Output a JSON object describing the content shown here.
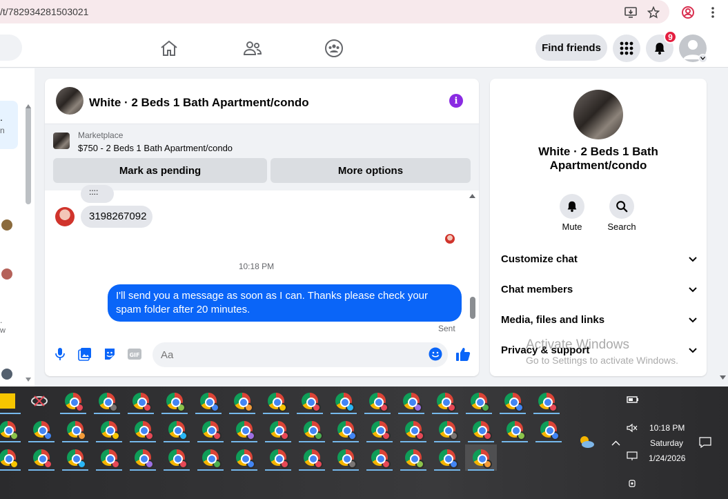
{
  "browser": {
    "url": "/t/782934281503021"
  },
  "nav": {
    "find_friends": "Find friends",
    "notification_count": "9"
  },
  "chat": {
    "title": "White · 2 Beds 1 Bath Apartment/condo",
    "marketplace_label": "Marketplace",
    "listing": "$750 - 2 Beds 1 Bath Apartment/condo",
    "mark_pending": "Mark as pending",
    "more_options": "More options",
    "partial_msg": "::::",
    "phone_msg": "3198267092",
    "timestamp": "10:18 PM",
    "outgoing_msg": "I'll send you a message as soon as I can. Thanks please check your spam folder after 20 minutes.",
    "sent_status": "Sent",
    "input_placeholder": "Aa"
  },
  "info_panel": {
    "name": "White · 2 Beds 1 Bath Apartment/condo",
    "mute": "Mute",
    "search": "Search",
    "rows": [
      "Customize chat",
      "Chat members",
      "Media, files and links",
      "Privacy & support"
    ]
  },
  "watermark": {
    "line1": "Activate Windows",
    "line2": "Go to Settings to activate Windows."
  },
  "taskbar": {
    "time": "10:18 PM",
    "day": "Saturday",
    "date": "1/24/2026"
  },
  "colors": {
    "messenger_blue": "#0a65f8",
    "badge_red": "#e41e3f",
    "info_purple": "#8a2be2"
  }
}
